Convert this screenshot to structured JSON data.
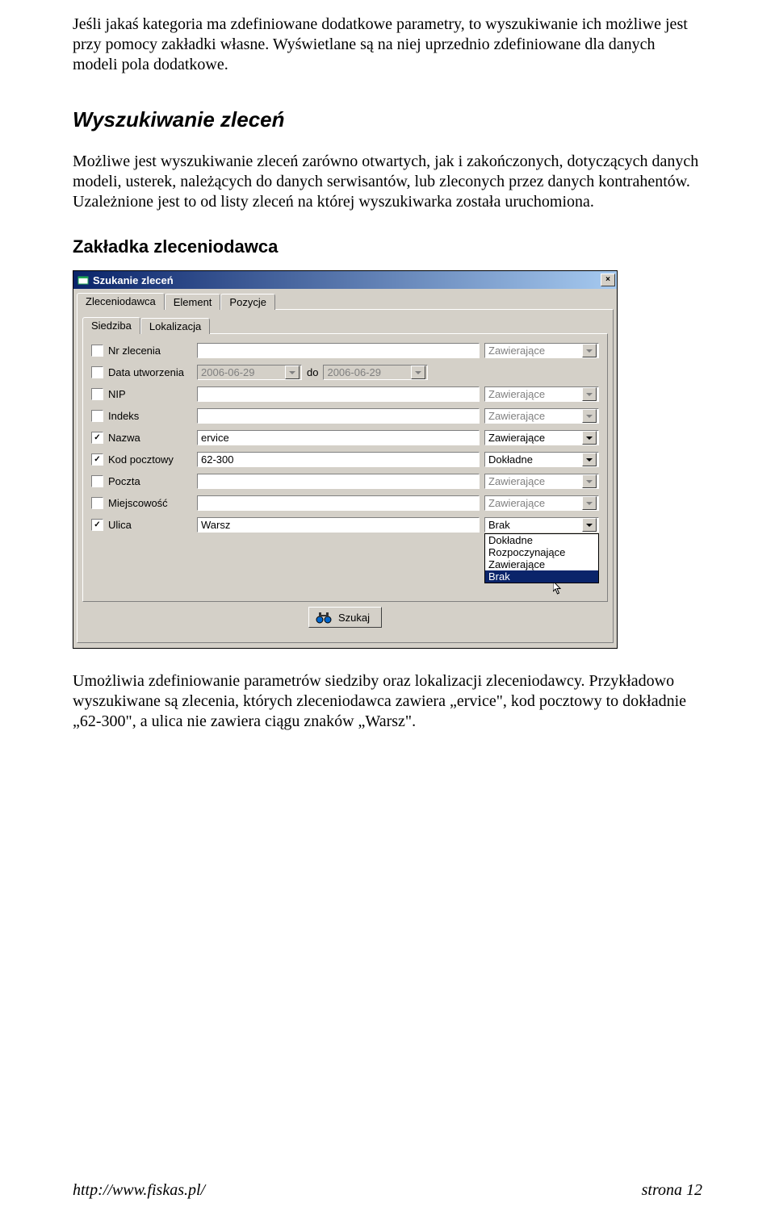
{
  "intro": {
    "p1": "Jeśli jakaś kategoria ma zdefiniowane dodatkowe parametry, to wyszukiwanie ich możliwe jest przy pomocy zakładki własne. Wyświetlane są na niej uprzednio zdefiniowane dla danych modeli pola dodatkowe."
  },
  "heading1": "Wyszukiwanie zleceń",
  "body1": "Możliwe jest wyszukiwanie zleceń zarówno otwartych, jak i zakończonych, dotyczących danych modeli, usterek, należących do danych serwisantów, lub zleconych przez danych kontrahentów. Uzależnione jest to od listy zleceń na której wyszukiwarka została uruchomiona.",
  "heading2": "Zakładka zleceniodawca",
  "dialog": {
    "title": "Szukanie zleceń",
    "close_x": "×",
    "tabs_top": [
      "Zleceniodawca",
      "Element",
      "Pozycje"
    ],
    "tabs_inner": [
      "Siedziba",
      "Lokalizacja"
    ],
    "rows": [
      {
        "checked": false,
        "label": "Nr zlecenia",
        "value": "",
        "match": "Zawierające",
        "enabled": false
      },
      {
        "checked": false,
        "label": "Data utworzenia",
        "value": "",
        "match": "",
        "enabled": false,
        "date_from": "2006-06-29",
        "date_to": "2006-06-29",
        "do": "do"
      },
      {
        "checked": false,
        "label": "NIP",
        "value": "",
        "match": "Zawierające",
        "enabled": false
      },
      {
        "checked": false,
        "label": "Indeks",
        "value": "",
        "match": "Zawierające",
        "enabled": false
      },
      {
        "checked": true,
        "label": "Nazwa",
        "value": "ervice",
        "match": "Zawierające",
        "enabled": true
      },
      {
        "checked": true,
        "label": "Kod pocztowy",
        "value": "62-300",
        "match": "Dokładne",
        "enabled": true
      },
      {
        "checked": false,
        "label": "Poczta",
        "value": "",
        "match": "Zawierające",
        "enabled": false
      },
      {
        "checked": false,
        "label": "Miejscowość",
        "value": "",
        "match": "Zawierające",
        "enabled": false
      },
      {
        "checked": true,
        "label": "Ulica",
        "value": "Warsz",
        "match": "Brak",
        "enabled": true,
        "open": true
      }
    ],
    "dropdown_options": [
      "Dokładne",
      "Rozpoczynające",
      "Zawierające",
      "Brak"
    ],
    "search_label": "Szukaj"
  },
  "body2": "Umożliwia zdefiniowanie parametrów siedziby oraz lokalizacji zleceniodawcy. Przykładowo wyszukiwane są zlecenia, których zleceniodawca zawiera „ervice\", kod pocztowy to dokładnie „62-300\", a ulica nie zawiera ciągu znaków „Warsz\".",
  "footer": {
    "left": "http://www.fiskas.pl/",
    "right": "strona 12"
  }
}
